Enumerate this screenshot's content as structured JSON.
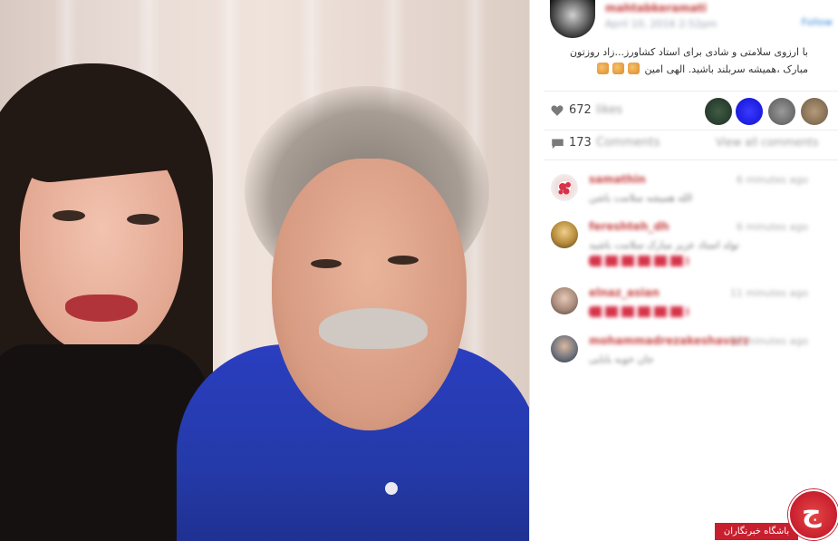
{
  "post": {
    "username": "mahtabkeramati",
    "date": "April 10, 2016 2:52pm",
    "follow_label": "Follow",
    "caption_line1": "با ارزوی سلامتی و شادی برای استاد کشاورز...زاد روزتون",
    "caption_line2": "مبارک ،همیشه سربلند باشید. الهی امین",
    "likes_count": "672",
    "likes_label": "likes",
    "comments_count": "173",
    "comments_label": "Comments",
    "view_all_label": "View all comments"
  },
  "comments": [
    {
      "user": "samathin",
      "time": "6 minutes ago",
      "text": "الله همیشه سلامت باشن"
    },
    {
      "user": "fereshteh_dh",
      "time": "6 minutes ago",
      "text": "تولد استاد عزیز مبارک سلامت باشید"
    },
    {
      "user": "elnaz_asian",
      "time": "11 minutes ago",
      "text": ""
    },
    {
      "user": "mohammadrezakeshavarz",
      "time": "12 minutes ago",
      "text": "جان خوبه بابایی"
    }
  ],
  "watermark": {
    "glyph": "ج",
    "label": "باشگاه خبرنگاران"
  },
  "colors": {
    "accent_red": "#c81f2e",
    "shirt_blue": "#2a3ec0"
  }
}
